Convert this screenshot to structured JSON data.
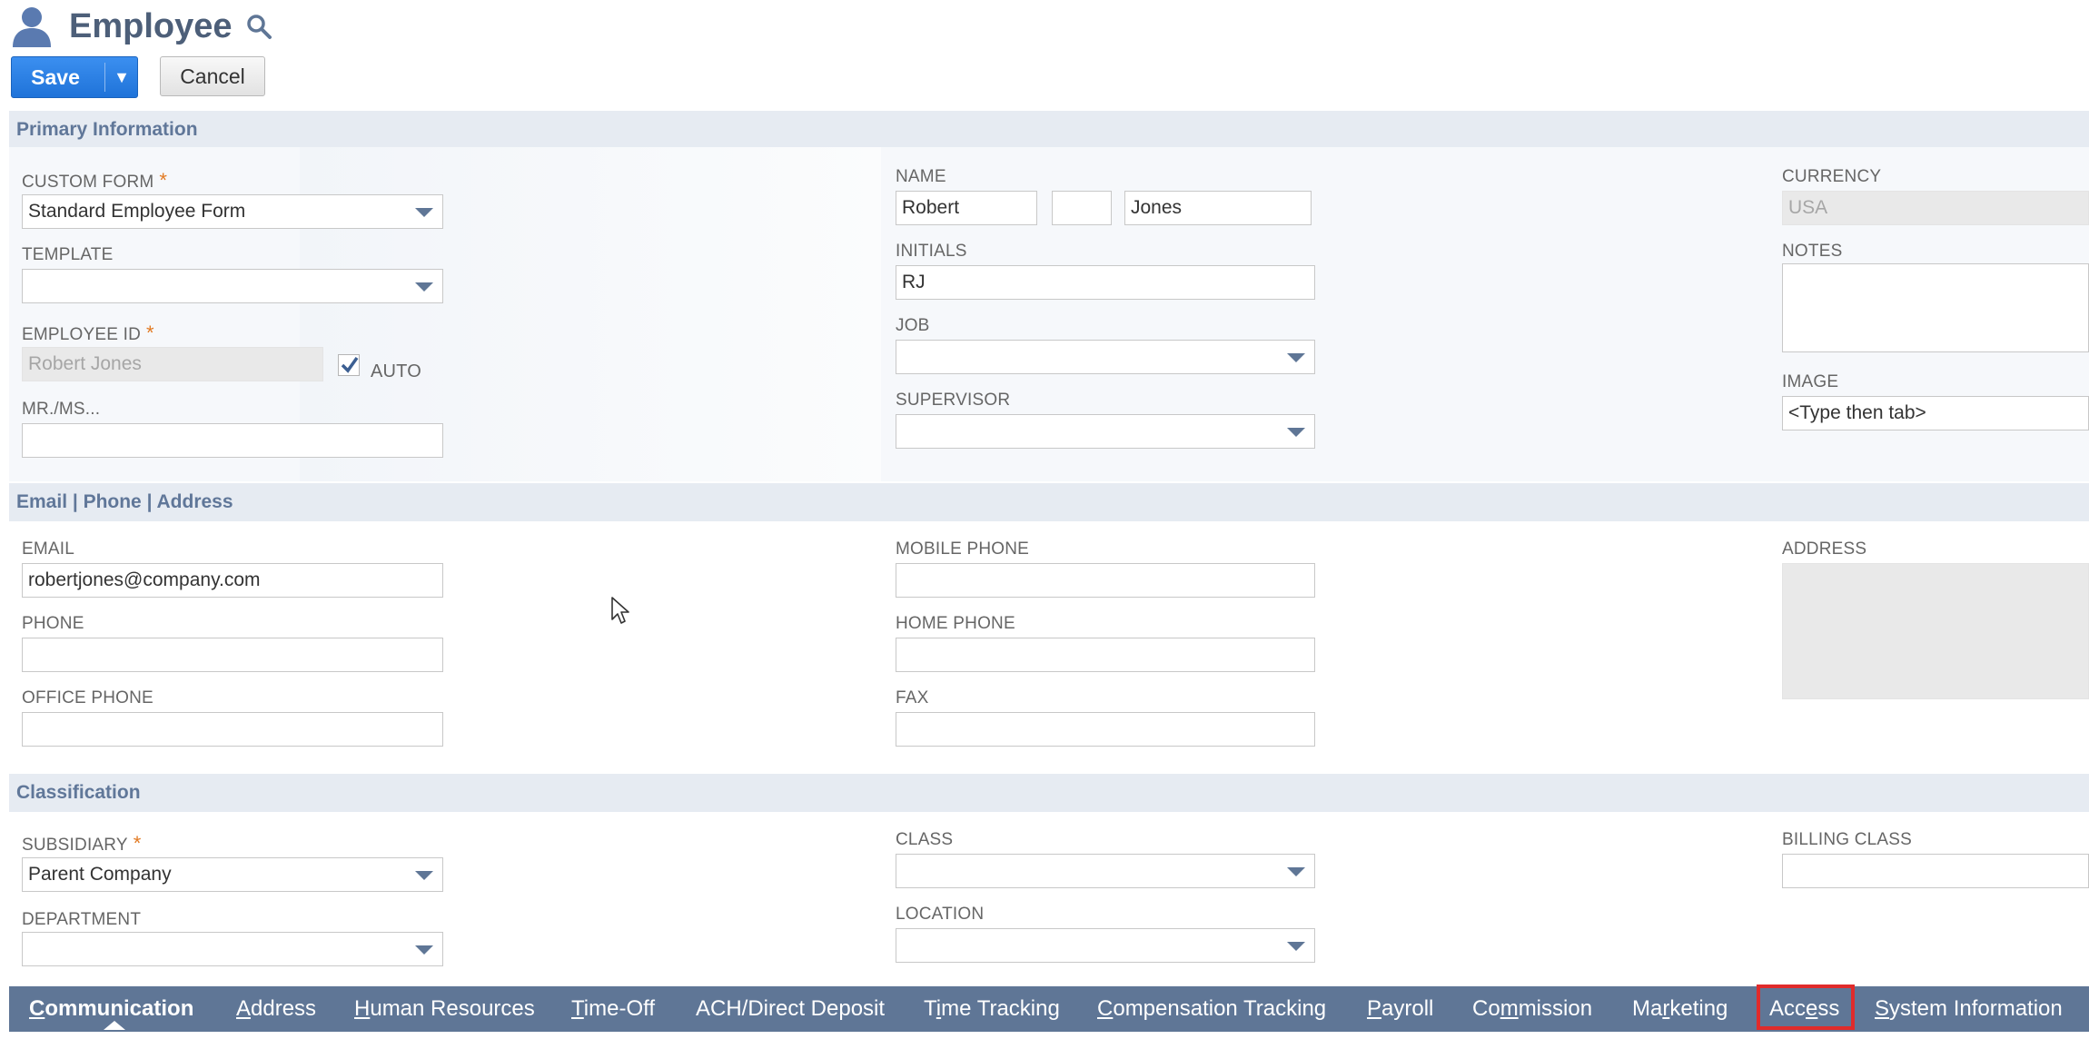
{
  "header": {
    "title": "Employee",
    "icons": {
      "title": "person-icon",
      "search": "search-icon"
    },
    "save_label": "Save",
    "save_menu_caret": "▼",
    "cancel_label": "Cancel"
  },
  "sections": {
    "primary": "Primary Information",
    "contact": "Email | Phone | Address",
    "classification": "Classification"
  },
  "primary": {
    "custom_form": {
      "label": "CUSTOM FORM",
      "value": "Standard Employee Form",
      "required": "*"
    },
    "template": {
      "label": "TEMPLATE",
      "value": ""
    },
    "employee_id": {
      "label": "EMPLOYEE ID",
      "value": "Robert Jones",
      "required": "*",
      "auto_label": "AUTO",
      "auto_checked": true
    },
    "mr_ms": {
      "label": "MR./MS...",
      "value": ""
    },
    "name": {
      "label": "NAME",
      "first": "Robert",
      "middle": "",
      "last": "Jones"
    },
    "initials": {
      "label": "INITIALS",
      "value": "RJ"
    },
    "job": {
      "label": "JOB",
      "value": ""
    },
    "supervisor": {
      "label": "SUPERVISOR",
      "value": ""
    },
    "currency": {
      "label": "CURRENCY",
      "value": "USA"
    },
    "notes": {
      "label": "NOTES",
      "value": ""
    },
    "image": {
      "label": "IMAGE",
      "value": "<Type then tab>"
    }
  },
  "contact": {
    "email": {
      "label": "EMAIL",
      "value": "robertjones@company.com"
    },
    "phone": {
      "label": "PHONE",
      "value": ""
    },
    "office_phone": {
      "label": "OFFICE PHONE",
      "value": ""
    },
    "mobile_phone": {
      "label": "MOBILE PHONE",
      "value": ""
    },
    "home_phone": {
      "label": "HOME PHONE",
      "value": ""
    },
    "fax": {
      "label": "FAX",
      "value": ""
    },
    "address": {
      "label": "ADDRESS",
      "value": ""
    }
  },
  "classification": {
    "subsidiary": {
      "label": "SUBSIDIARY",
      "value": "Parent Company",
      "required": "*"
    },
    "department": {
      "label": "DEPARTMENT",
      "value": ""
    },
    "class": {
      "label": "CLASS",
      "value": ""
    },
    "location": {
      "label": "LOCATION",
      "value": ""
    },
    "billing_class": {
      "label": "BILLING CLASS",
      "value": ""
    }
  },
  "tabs": [
    {
      "pre": "",
      "u": "C",
      "post": "ommunication",
      "active": true
    },
    {
      "pre": "",
      "u": "A",
      "post": "ddress"
    },
    {
      "pre": "",
      "u": "H",
      "post": "uman Resources"
    },
    {
      "pre": "",
      "u": "T",
      "post": "ime-Off"
    },
    {
      "pre": "ACH/Direct Deposit",
      "u": "",
      "post": ""
    },
    {
      "pre": "T",
      "u": "i",
      "post": "me Tracking"
    },
    {
      "pre": "",
      "u": "C",
      "post": "ompensation Tracking"
    },
    {
      "pre": "",
      "u": "P",
      "post": "ayroll"
    },
    {
      "pre": "Co",
      "u": "m",
      "post": "mission"
    },
    {
      "pre": "Ma",
      "u": "r",
      "post": "keting"
    },
    {
      "pre": "Acc",
      "u": "e",
      "post": "ss",
      "highlighted": true
    },
    {
      "pre": "",
      "u": "S",
      "post": "ystem Information"
    }
  ],
  "colors": {
    "accent": "#1f73d9",
    "section_bg": "#e6ebf2",
    "tab_bg": "#5f7696",
    "highlight": "#e02b2b"
  }
}
